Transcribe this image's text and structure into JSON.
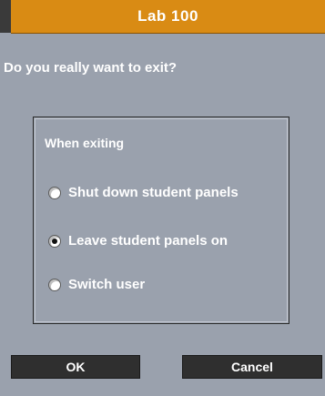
{
  "window": {
    "title": "Lab 100"
  },
  "dialog": {
    "question": "Do you really want to exit?",
    "group_label": "When exiting",
    "options": [
      {
        "label": "Shut down student panels",
        "checked": false
      },
      {
        "label": "Leave student panels on",
        "checked": true
      },
      {
        "label": "Switch user",
        "checked": false
      }
    ],
    "ok_label": "OK",
    "cancel_label": "Cancel"
  },
  "colors": {
    "titlebar": "#d98b14",
    "background": "#9aa1ad",
    "button": "#2f2f2f"
  }
}
